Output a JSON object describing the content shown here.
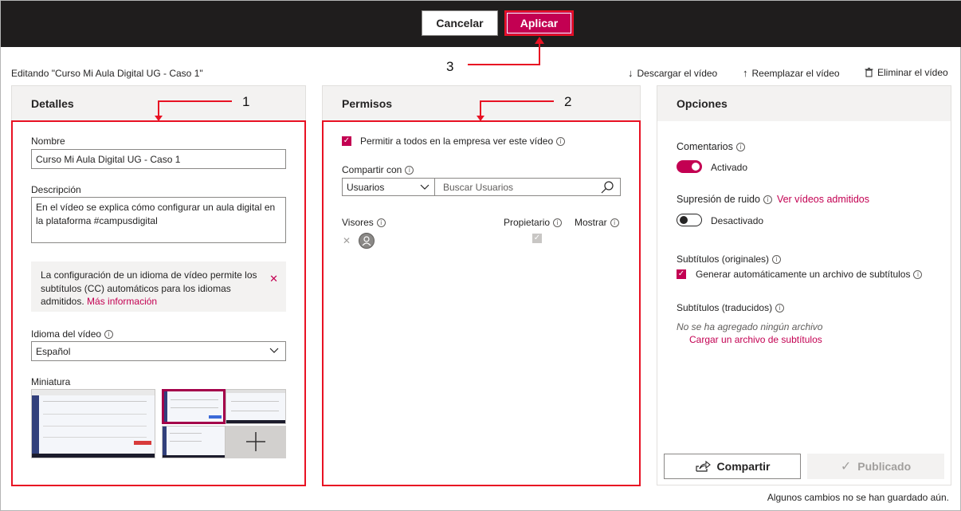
{
  "topbar": {
    "cancel_label": "Cancelar",
    "apply_label": "Aplicar"
  },
  "editing_title": "Editando \"Curso Mi Aula Digital UG - Caso 1\"",
  "actions": {
    "download": "Descargar el vídeo",
    "replace": "Reemplazar el vídeo",
    "delete": "Eliminar el vídeo"
  },
  "annotations": {
    "one": "1",
    "two": "2",
    "three": "3"
  },
  "details": {
    "title": "Detalles",
    "name_label": "Nombre",
    "name_value": "Curso Mi Aula Digital UG - Caso 1",
    "desc_label": "Descripción",
    "desc_value": "En el vídeo se explica cómo configurar un aula digital en la plataforma #campusdigital",
    "notice_text": "La configuración de un idioma de vídeo permite los subtítulos (CC) automáticos para los idiomas admitidos.",
    "notice_link": "Más información",
    "language_label": "Idioma del vídeo",
    "language_value": "Español",
    "thumbnail_label": "Miniatura"
  },
  "permissions": {
    "title": "Permisos",
    "allow_all_label": "Permitir a todos en la empresa ver este vídeo",
    "share_with_label": "Compartir con",
    "share_type_value": "Usuarios",
    "search_placeholder": "Buscar Usuarios",
    "viewers_label": "Visores",
    "owner_label": "Propietario",
    "show_label": "Mostrar"
  },
  "options": {
    "title": "Opciones",
    "comments_label": "Comentarios",
    "comments_state": "Activado",
    "noise_label": "Supresión de ruido",
    "noise_link": "Ver vídeos admitidos",
    "noise_state": "Desactivado",
    "subs_original_label": "Subtítulos (originales)",
    "subs_auto_label": "Generar automáticamente un archivo de subtítulos",
    "subs_translated_label": "Subtítulos (traducidos)",
    "no_file_text": "No se ha agregado ningún archivo",
    "upload_link": "Cargar un archivo de subtítulos",
    "share_label": "Compartir",
    "published_label": "Publicado"
  },
  "footer_note": "Algunos cambios no se han guardado aún.",
  "colors": {
    "accent": "#c30052",
    "annotation_red": "#e81123",
    "topbar": "#1f1d1d"
  }
}
